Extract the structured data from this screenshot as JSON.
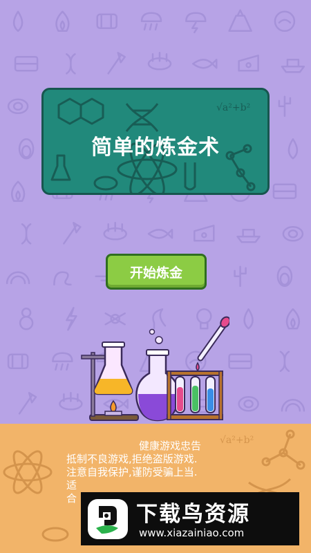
{
  "game": {
    "title": "简单的炼金术",
    "start_button_label": "开始炼金"
  },
  "health_notice": {
    "title": "健康游戏忠告",
    "lines": [
      "抵制不良游戏,拒绝盗版游戏.",
      "注意自我保护,谨防受骗上当.",
      "适",
      "合"
    ]
  },
  "watermark": {
    "name": "下载鸟资源",
    "url": "www.xiazainiao.com"
  },
  "background_icons": [
    "water-drop-icon",
    "fire-icon",
    "fossil-icon",
    "rain-cloud-icon",
    "storm-cloud-icon",
    "volcano-icon",
    "fishbowl-icon",
    "field-icon",
    "dna-icon",
    "axe-icon",
    "swamp-icon",
    "fish-icon",
    "cheese-icon",
    "boat-icon",
    "egg-icon",
    "rainbow-icon",
    "snake-icon",
    "airplane-icon",
    "car-icon",
    "sausage-icon",
    "cactus-icon",
    "penguin-icon",
    "snowman-icon",
    "lightning-icon",
    "candy-icon",
    "sickle-icon",
    "lightbulb-icon"
  ],
  "colors": {
    "background": "#b7a3e6",
    "title_card": "#21897b",
    "start_button": "#8ccc44",
    "bottom_panel": "#f2b469",
    "watermark_bg": "#0d0d0d"
  }
}
